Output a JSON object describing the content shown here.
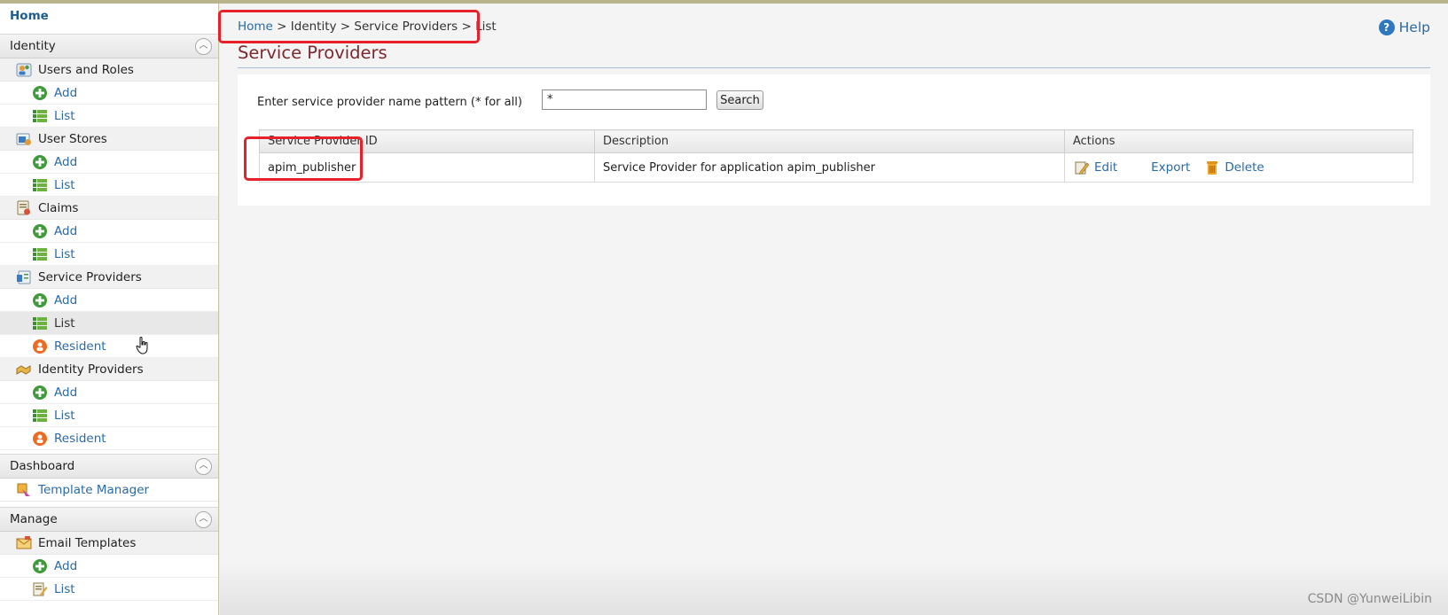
{
  "sidebar": {
    "home_label": "Home",
    "sections": [
      {
        "title": "Identity",
        "groups": [
          {
            "label": "Users and Roles",
            "icon": "users-roles-icon",
            "items": [
              {
                "label": "Add",
                "icon": "add-icon"
              },
              {
                "label": "List",
                "icon": "list-icon"
              }
            ]
          },
          {
            "label": "User Stores",
            "icon": "user-stores-icon",
            "items": [
              {
                "label": "Add",
                "icon": "add-icon"
              },
              {
                "label": "List",
                "icon": "list-icon"
              }
            ]
          },
          {
            "label": "Claims",
            "icon": "claims-icon",
            "items": [
              {
                "label": "Add",
                "icon": "add-icon"
              },
              {
                "label": "List",
                "icon": "list-icon"
              }
            ]
          },
          {
            "label": "Service Providers",
            "icon": "service-providers-icon",
            "items": [
              {
                "label": "Add",
                "icon": "add-icon"
              },
              {
                "label": "List",
                "icon": "list-icon",
                "selected": true
              },
              {
                "label": "Resident",
                "icon": "resident-icon"
              }
            ]
          },
          {
            "label": "Identity Providers",
            "icon": "identity-providers-icon",
            "items": [
              {
                "label": "Add",
                "icon": "add-icon"
              },
              {
                "label": "List",
                "icon": "list-icon"
              },
              {
                "label": "Resident",
                "icon": "resident-icon"
              }
            ]
          }
        ]
      },
      {
        "title": "Dashboard",
        "links": [
          {
            "label": "Template Manager",
            "icon": "template-manager-icon"
          }
        ]
      },
      {
        "title": "Manage",
        "groups": [
          {
            "label": "Email Templates",
            "icon": "email-templates-icon",
            "items": [
              {
                "label": "Add",
                "icon": "add-icon"
              },
              {
                "label": "List",
                "icon": "edit-list-icon"
              }
            ]
          }
        ]
      }
    ]
  },
  "breadcrumb": {
    "home": "Home",
    "rest": " > Identity > Service Providers > List"
  },
  "help_label": "Help",
  "page_title": "Service Providers",
  "search": {
    "label": "Enter service provider name pattern (* for all)",
    "value": "*",
    "button": "Search"
  },
  "table": {
    "headers": [
      "Service Provider ID",
      "Description",
      "Actions"
    ],
    "rows": [
      {
        "id": "apim_publisher",
        "description": "Service Provider for application apim_publisher"
      }
    ],
    "actions": {
      "edit": "Edit",
      "export": "Export",
      "delete": "Delete"
    }
  },
  "watermark": "CSDN @YunweiLibin",
  "colors": {
    "link": "#2a6aa6",
    "title": "#7a2930",
    "highlight": "#e8202a"
  }
}
